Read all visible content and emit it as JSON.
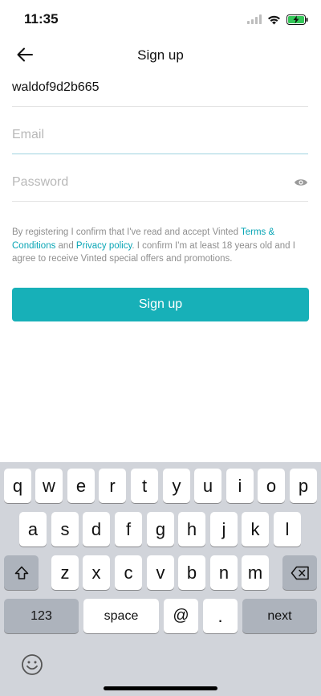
{
  "status_bar": {
    "time": "11:35"
  },
  "nav": {
    "title": "Sign up"
  },
  "form": {
    "username_value": "waldof9d2b665",
    "email_placeholder": "Email",
    "password_placeholder": "Password"
  },
  "legal": {
    "part1": "By registering I confirm that I've read and accept Vinted ",
    "terms_link": "Terms & Conditions",
    "part2": " and ",
    "privacy_link": "Privacy policy",
    "part3": ". I confirm I'm at least 18 years old and I agree to receive Vinted special offers and promotions."
  },
  "signup_button": {
    "label": "Sign up"
  },
  "colors": {
    "accent": "#17b0b8",
    "link": "#08a5b5"
  },
  "keyboard": {
    "row1": [
      "q",
      "w",
      "e",
      "r",
      "t",
      "y",
      "u",
      "i",
      "o",
      "p"
    ],
    "row2": [
      "a",
      "s",
      "d",
      "f",
      "g",
      "h",
      "j",
      "k",
      "l"
    ],
    "row3": [
      "z",
      "x",
      "c",
      "v",
      "b",
      "n",
      "m"
    ],
    "shift_icon": "shift-icon",
    "delete_icon": "backspace-icon",
    "numbers_label": "123",
    "space_label": "space",
    "at_label": "@",
    "dot_label": ".",
    "next_label": "next",
    "emoji_icon": "emoji-icon"
  }
}
